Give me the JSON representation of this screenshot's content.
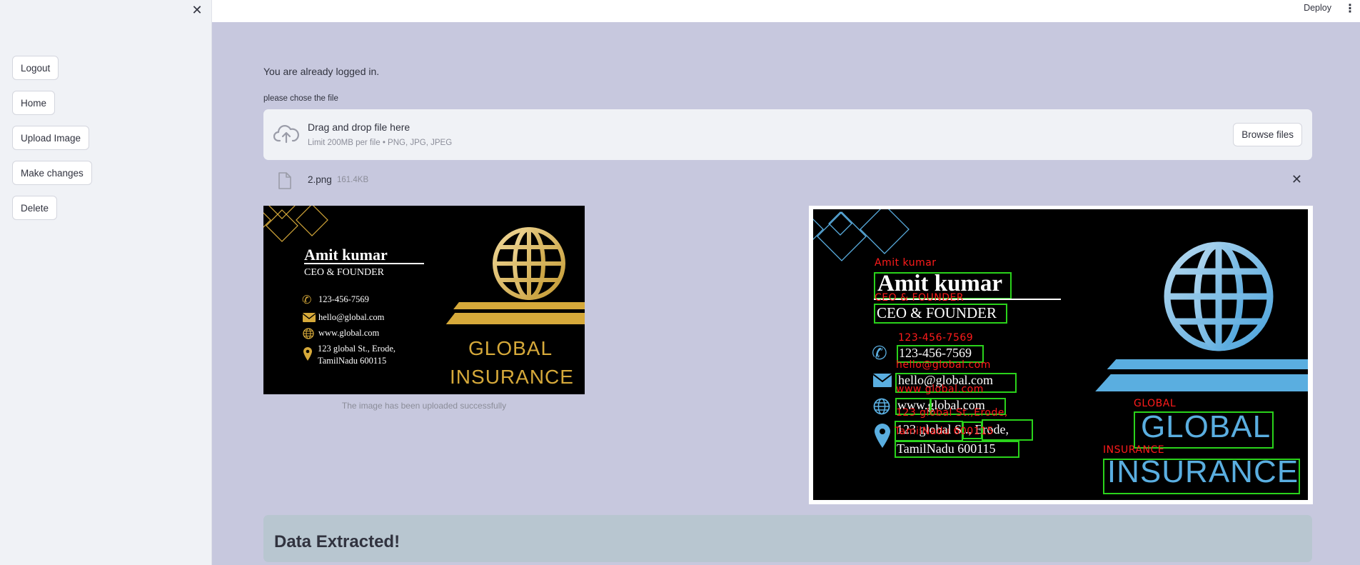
{
  "sidebar": {
    "close_icon": "close-icon",
    "buttons": [
      {
        "label": "Logout"
      },
      {
        "label": "Home"
      },
      {
        "label": "Upload Image"
      },
      {
        "label": "Make changes"
      },
      {
        "label": "Delete"
      }
    ]
  },
  "header": {
    "deploy_label": "Deploy",
    "menu_icon": "kebab-menu-icon"
  },
  "main": {
    "login_message": "You are already logged in.",
    "uploader_label": "please chose the file",
    "dropzone": {
      "title": "Drag and drop file here",
      "subtitle": "Limit 200MB per file • PNG, JPG, JPEG",
      "browse_label": "Browse files"
    },
    "file": {
      "name": "2.png",
      "size": "161.4KB"
    },
    "caption": "The image has been uploaded successfully",
    "data_title": "Data Extracted!"
  },
  "card": {
    "name": "Amit kumar",
    "role": "CEO & FOUNDER",
    "phone": "123-456-7569",
    "email": "hello@global.com",
    "website": "www.global.com",
    "address_line1": "123 global St., Erode,",
    "address_line2": "TamilNadu 600115",
    "brand_line1": "GLOBAL",
    "brand_line2": "INSURANCE",
    "accent_left": "#d6a93a",
    "accent_right": "#5aaee0"
  },
  "ocr_labels": {
    "name": "Amit kumar",
    "role": "CEO & FOUNDER",
    "phone": "123-456-7569",
    "email": "hello@global.com",
    "website": "www   global.com",
    "address1": "123 global St.,Erode,",
    "address2": "TamilNadu 600115",
    "brand1": "GLOBAL",
    "brand2": "INSURANCE"
  },
  "colors": {
    "background": "#c7c8de",
    "sidebar": "#f0f2f6",
    "ocr_box": "#2ad21b",
    "ocr_text": "#ff1b1b"
  }
}
